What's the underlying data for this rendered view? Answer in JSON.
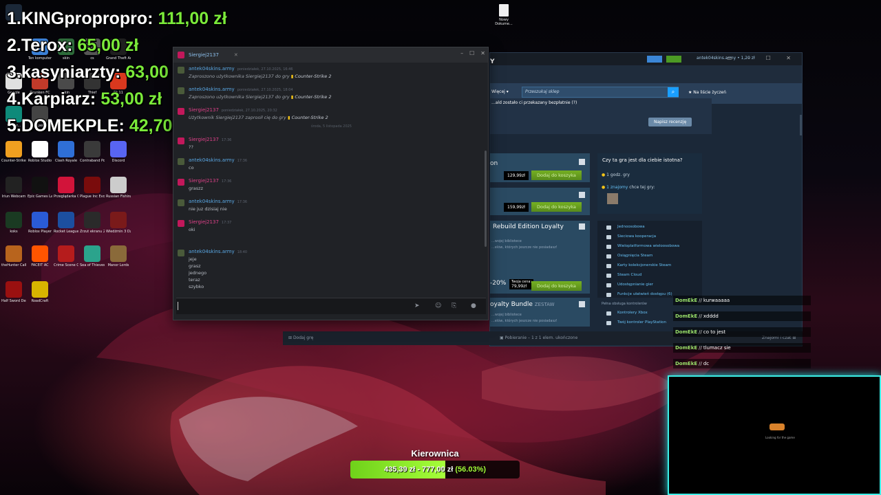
{
  "leaderboard": [
    {
      "rank": "1.",
      "name": "KINGpropropro:",
      "amount": "111,00 zł"
    },
    {
      "rank": "2.",
      "name": "Terox:",
      "amount": "65,00 zł"
    },
    {
      "rank": "3.",
      "name": "kasyniarzty:",
      "amount": "63,00 zł"
    },
    {
      "rank": "4.",
      "name": "Karpiarz:",
      "amount": "53,00 zł"
    },
    {
      "rank": "5.",
      "name": "DOMEKPLE:",
      "amount": "42,70 zł"
    }
  ],
  "desktop_icons": [
    {
      "label": "Steam",
      "color": "#1b2838"
    },
    {
      "label": "Ten komputer",
      "color": "#3b7fd4"
    },
    {
      "label": "skin",
      "color": "#2d6b3a"
    },
    {
      "label": "cs",
      "color": "#555555"
    },
    {
      "label": "Grand Theft Auto V Le...",
      "color": "#1f1f1f"
    },
    {
      "label": "Google",
      "color": "#e0e0e0"
    },
    {
      "label": "Drunken FC",
      "color": "#c23a2a"
    },
    {
      "label": "skin",
      "color": "#4a4a4a"
    },
    {
      "label": "Thief",
      "color": "#333333"
    },
    {
      "label": "Fit 11",
      "color": "#d9381e"
    },
    {
      "label": "Stellar...",
      "color": "#0e8a7a"
    },
    {
      "label": "Super...",
      "color": "#444444"
    },
    {
      "label": "Counter-Strike 2",
      "color": "#f0a020"
    },
    {
      "label": "Roblox Studio",
      "color": "#ffffff"
    },
    {
      "label": "Clash Royale",
      "color": "#2f6fd6"
    },
    {
      "label": "Contraband Police",
      "color": "#3a3a3a"
    },
    {
      "label": "Discord",
      "color": "#5865f2"
    },
    {
      "label": "Iriun Webcam",
      "color": "#222222"
    },
    {
      "label": "Epic Games Launcher",
      "color": "#111111"
    },
    {
      "label": "Przeglądarka Opera GX",
      "color": "#d2143a"
    },
    {
      "label": "Plague Inc Evolved",
      "color": "#7a0c0c"
    },
    {
      "label": "Russian Fishing 4",
      "color": "#cccccc"
    },
    {
      "label": "koks",
      "color": "#1a3a22"
    },
    {
      "label": "Roblox Player",
      "color": "#2a5bd7"
    },
    {
      "label": "Rocket League®",
      "color": "#1c4fa0"
    },
    {
      "label": "Zrzut ekranu 2025-08-...",
      "color": "#2a2a2a"
    },
    {
      "label": "Wiedźmin 3 Dziki Gon",
      "color": "#7a1a1a"
    },
    {
      "label": "theHunter Call of t...",
      "color": "#b8641d"
    },
    {
      "label": "FACEIT AC",
      "color": "#ff5500"
    },
    {
      "label": "Crime Scene Cleaner",
      "color": "#b51c1c"
    },
    {
      "label": "Sea of Thieves",
      "color": "#2ba38c"
    },
    {
      "label": "Manor Lords",
      "color": "#8a6a3a"
    },
    {
      "label": "Half Sword Demo",
      "color": "#9a1010"
    },
    {
      "label": "RoadCraft",
      "color": "#d8b400"
    }
  ],
  "desktop_file": {
    "label": "Nowy Dokume..."
  },
  "chat": {
    "tab_title": "Siergiej2137",
    "messages": [
      {
        "name": "antek04skins.army",
        "time": "poniedziałek, 27.10.2025, 16:46",
        "lines": [
          "Zaproszono użytkownika Siergiej2137 do gry"
        ],
        "game": "Counter-Strike 2",
        "type": "me"
      },
      {
        "name": "antek04skins.army",
        "time": "poniedziałek, 27.10.2025, 18:04",
        "lines": [
          "Zaproszono użytkownika Siergiej2137 do gry"
        ],
        "game": "Counter-Strike 2",
        "type": "me"
      },
      {
        "name": "Siergiej2137",
        "time": "poniedziałek, 27.10.2025, 20:32",
        "lines": [
          "Użytkownik Siergiej2137 zaprosił cię do gry"
        ],
        "game": "Counter-Strike 2",
        "type": "them"
      },
      {
        "name": "Siergiej2137",
        "time": "17:36",
        "lines": [
          "??"
        ],
        "game": "",
        "type": "them"
      },
      {
        "name": "antek04skins.army",
        "time": "17:36",
        "lines": [
          "co"
        ],
        "game": "",
        "type": "me"
      },
      {
        "name": "Siergiej2137",
        "time": "17:36",
        "lines": [
          "graszz"
        ],
        "game": "",
        "type": "them"
      },
      {
        "name": "antek04skins.army",
        "time": "17:36",
        "lines": [
          "nie juz dzisiaj nie"
        ],
        "game": "",
        "type": "me"
      },
      {
        "name": "Siergiej2137",
        "time": "17:37",
        "lines": [
          "oki"
        ],
        "game": "",
        "type": "them"
      },
      {
        "name": "antek04skins.army",
        "time": "18:40",
        "lines": [
          "jeje",
          "grasz",
          "jednego",
          "teraz",
          "szybko"
        ],
        "game": "",
        "type": "me"
      }
    ],
    "date_separator": "środa, 5 listopada 2025",
    "colors": {
      "me": "#5aa9e6",
      "them": "#e0418a"
    }
  },
  "steam": {
    "user": "antek04skins.army • 1,20 zł",
    "title_fragment": "Y",
    "more_label": "Więcej",
    "search_placeholder": "Przeszukaj sklep",
    "wishlist_label": "Na liście życzeń",
    "free_note": "...ald zostało ci przekazany bezpłatnie (?)",
    "write_review": "Napisz recenzję",
    "items": [
      {
        "title": "on",
        "price": "129,99zł",
        "cart": "Dodaj do koszyka"
      },
      {
        "title": "",
        "price": "159,99zł",
        "cart": "Dodaj do koszyka"
      },
      {
        "title": "Rebuild Edition Loyalty",
        "sub1": "...wojej bibliotece",
        "sub2": "...elów, których jeszcze nie posiadasz!",
        "discount": "-20%",
        "price_label": "Twoja cena:",
        "price": "79,99zł",
        "cart": "Dodaj do koszyka"
      },
      {
        "title": "oyalty Bundle",
        "tag": "ZESTAW",
        "sub1": "...wojej bibliotece",
        "sub2": "...elów, których jeszcze nie posiadasz!"
      }
    ],
    "relevance": {
      "title": "Czy ta gra jest dla ciebie istotna?",
      "hours": "1 godz. gry",
      "friends_count": "1 znajomy",
      "friends_text": "chce tej gry:"
    },
    "features": [
      "Jednoosobowa",
      "Sieciowa kooperacja",
      "Wieloplatformowa wieloosobowa",
      "Osiągnięcia Steam",
      "Karty kolekcjonerskie Steam",
      "Steam Cloud",
      "Udostępnianie gier",
      "Funkcje ułatwień dostępu (6)"
    ],
    "controllers_title": "Pełna obsługa kontrolerów",
    "controllers": [
      "Kontrolery Xbox",
      "Twój kontroler PlayStation"
    ],
    "bottom": {
      "add_game": "Dodaj grę",
      "download": "Pobieranie – 1 z 1 elem. ukończone",
      "friends": "Znajomi i czat"
    }
  },
  "twitch_chat": [
    {
      "user": "DomEkE",
      "sep": "//",
      "text": "kurwaaaaa"
    },
    {
      "user": "DomEkE",
      "sep": "//",
      "text": "xdddd"
    },
    {
      "user": "DomEkE",
      "sep": "//",
      "text": "co to jest"
    },
    {
      "user": "DomEkE",
      "sep": "//",
      "text": "tlumacz sie"
    },
    {
      "user": "DomEkE",
      "sep": "//",
      "text": "dc"
    }
  ],
  "webcam": {
    "status": "Looking for the game"
  },
  "goal": {
    "title": "Kierownica",
    "current": "435,39 zł",
    "sep": "-",
    "target": "777,00 zł",
    "percent_text": "(56.03%)",
    "progress": 0.5603
  }
}
